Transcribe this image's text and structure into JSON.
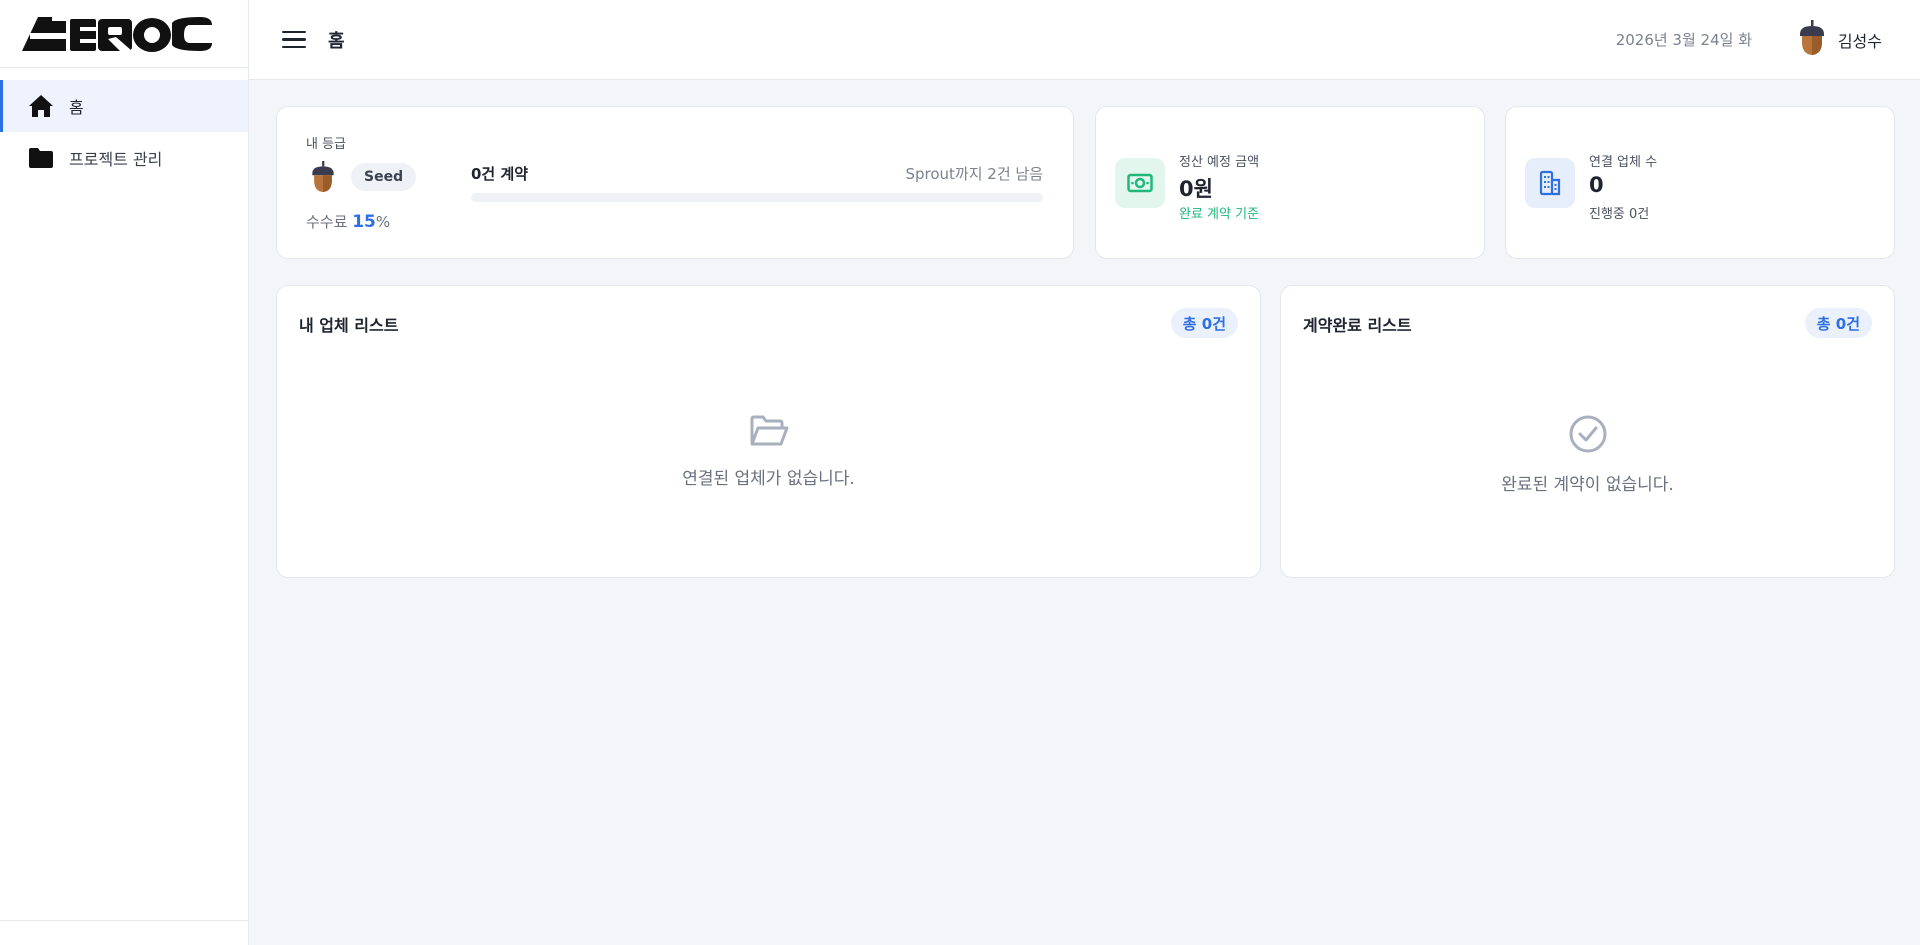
{
  "brand": {
    "logo_text": "AEROC"
  },
  "sidebar": {
    "items": [
      {
        "label": "홈",
        "icon": "home-icon",
        "active": true
      },
      {
        "label": "프로젝트 관리",
        "icon": "folder-icon",
        "active": false
      }
    ]
  },
  "header": {
    "title": "홈",
    "date": "2026년 3월 24일 화",
    "user_name": "김성수",
    "avatar_icon": "acorn-icon"
  },
  "grade": {
    "label": "내 등급",
    "badge": "Seed",
    "fee_prefix": "수수료",
    "fee_value": "15",
    "fee_unit": "%",
    "contract_count": "0건 계약",
    "next_level_text": "Sprout까지 2건 남음",
    "progress_fraction": 0
  },
  "settlement": {
    "label": "정산 예정 금액",
    "value": "0원",
    "sub": "완료 계약 기준",
    "icon": "cash-icon",
    "color": "#1fb77a"
  },
  "vendors_stat": {
    "label": "연결 업체 수",
    "value": "0",
    "sub": "진행중 0건",
    "icon": "building-icon",
    "color": "#2f6fe4"
  },
  "vendor_list": {
    "title": "내 업체 리스트",
    "total": "총 0건",
    "empty_text": "연결된 업체가 없습니다.",
    "empty_icon": "folder-open-icon"
  },
  "done_list": {
    "title": "계약완료 리스트",
    "total": "총 0건",
    "empty_text": "완료된 계약이 없습니다.",
    "empty_icon": "check-circle-icon"
  },
  "colors": {
    "accent": "#2f6fe4",
    "success": "#1fb77a",
    "background": "#f3f5f9"
  }
}
